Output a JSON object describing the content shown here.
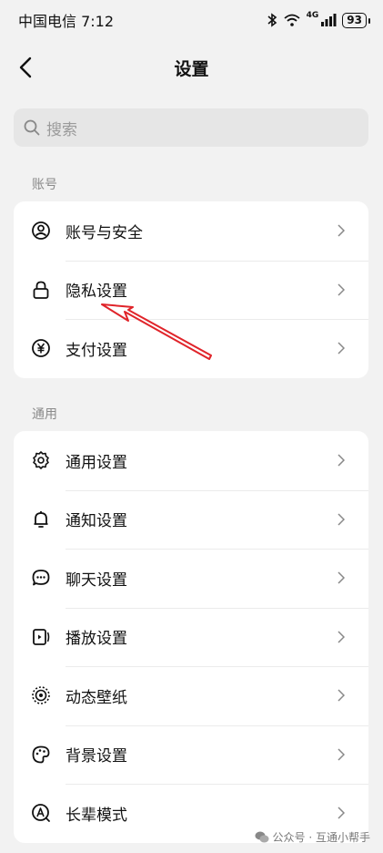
{
  "status_bar": {
    "carrier_time": "中国电信 7:12",
    "network": "4G",
    "battery": "93"
  },
  "nav": {
    "title": "设置"
  },
  "search": {
    "placeholder": "搜索"
  },
  "sections": [
    {
      "label": "账号",
      "items": [
        {
          "label": "账号与安全",
          "icon": "user-circle-icon"
        },
        {
          "label": "隐私设置",
          "icon": "lock-icon"
        },
        {
          "label": "支付设置",
          "icon": "yen-circle-icon"
        }
      ]
    },
    {
      "label": "通用",
      "items": [
        {
          "label": "通用设置",
          "icon": "gear-icon"
        },
        {
          "label": "通知设置",
          "icon": "bell-icon"
        },
        {
          "label": "聊天设置",
          "icon": "chat-bubble-icon"
        },
        {
          "label": "播放设置",
          "icon": "play-device-icon"
        },
        {
          "label": "动态壁纸",
          "icon": "live-wallpaper-icon"
        },
        {
          "label": "背景设置",
          "icon": "palette-icon"
        },
        {
          "label": "长辈模式",
          "icon": "elder-mode-icon"
        }
      ]
    }
  ],
  "watermark": {
    "text": "公众号 · 互通小帮手"
  },
  "colors": {
    "background": "#f2f2f2",
    "card": "#ffffff",
    "annotation_arrow": "#e0242a"
  }
}
